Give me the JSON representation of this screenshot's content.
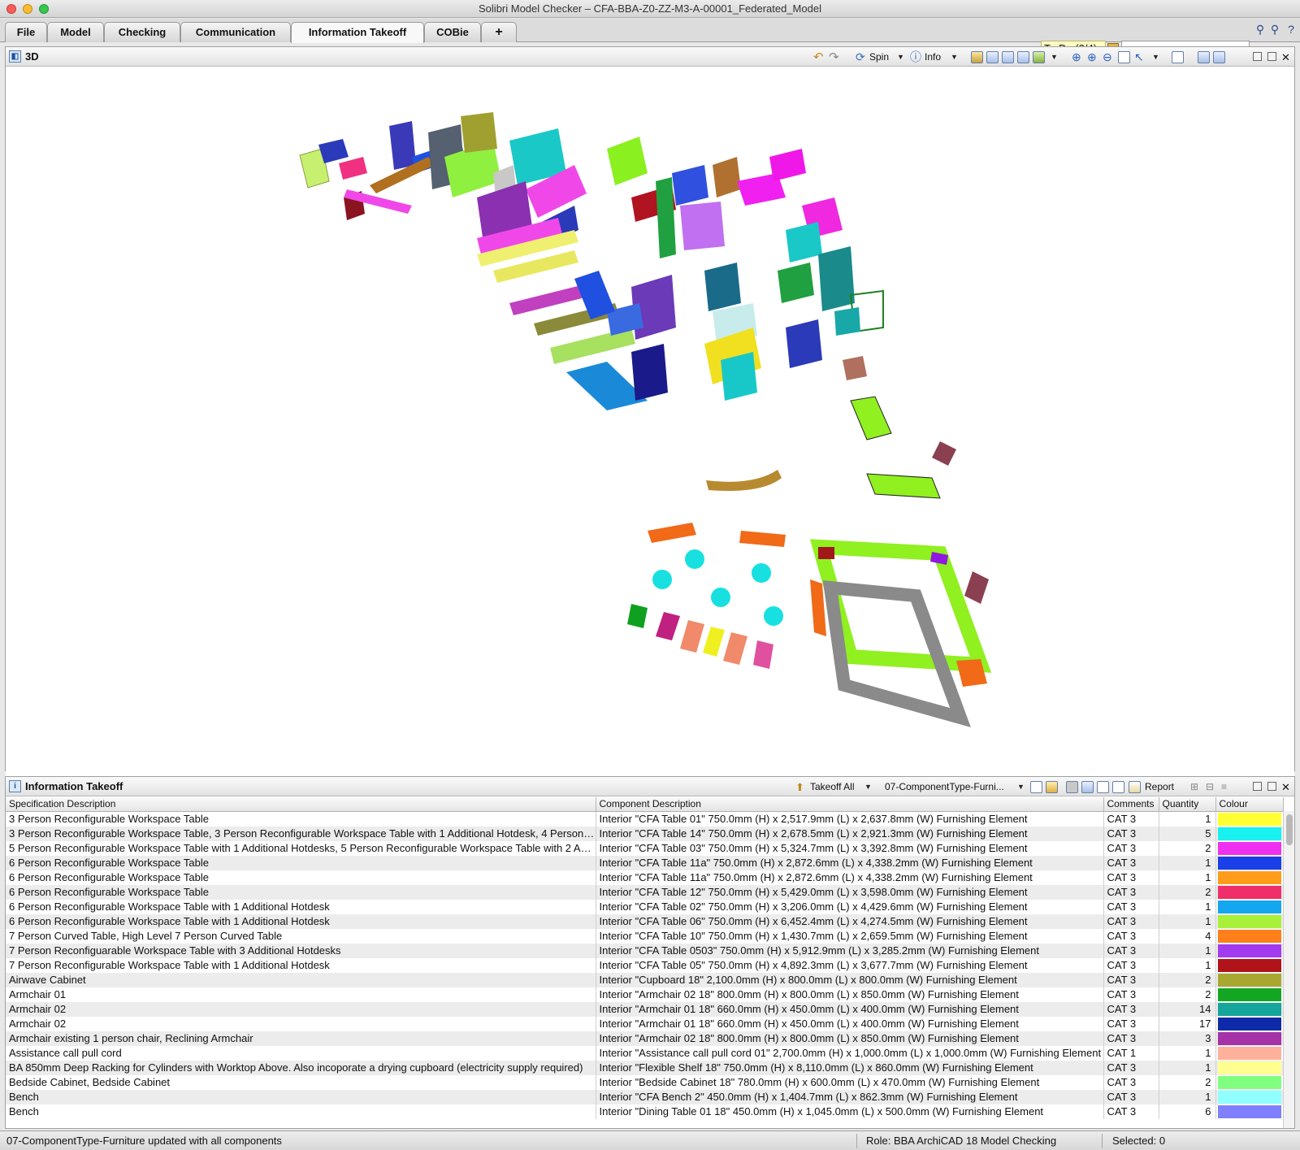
{
  "window": {
    "title": "Solibri Model Checker – CFA-BBA-Z0-ZZ-M3-A-00001_Federated_Model"
  },
  "tabs": [
    "File",
    "Model",
    "Checking",
    "Communication",
    "Information Takeoff",
    "COBie",
    "+"
  ],
  "todo": {
    "label": "To-Do (2/4)"
  },
  "search": {
    "value": ""
  },
  "view3d": {
    "title": "3D",
    "spin_label": "Spin",
    "info_label": "Info"
  },
  "takeoff": {
    "title": "Information Takeoff",
    "takeoff_all_label": "Takeoff All",
    "definition_label": "07-ComponentType-Furni...",
    "report_label": "Report",
    "columns": [
      "Specification Description",
      "Component Description",
      "Comments",
      "Quantity",
      "Colour"
    ],
    "rows": [
      {
        "spec": "3 Person Reconfigurable Workspace Table",
        "comp": "Interior \"CFA Table 01\" 750.0mm (H) x 2,517.9mm (L) x 2,637.8mm (W) Furnishing Element",
        "comments": "CAT 3",
        "qty": "1",
        "colour": "#ffff33"
      },
      {
        "spec": "3 Person Reconfigurable Workspace Table, 3 Person Reconfigurable Workspace Table with 1 Additional Hotdesk, 4 Person…",
        "comp": "Interior \"CFA Table 14\" 750.0mm (H) x 2,678.5mm (L) x 2,921.3mm (W) Furnishing Element",
        "comments": "CAT 3",
        "qty": "5",
        "colour": "#19f0f0"
      },
      {
        "spec": "5 Person Reconfigurable Workspace Table with 1 Additional Hotdesks, 5 Person Reconfigurable Workspace Table with 2 A…",
        "comp": "Interior \"CFA Table 03\" 750.0mm (H) x 5,324.7mm (L) x 3,392.8mm (W) Furnishing Element",
        "comments": "CAT 3",
        "qty": "2",
        "colour": "#f030f0"
      },
      {
        "spec": "6 Person Reconfigurable Workspace Table",
        "comp": "Interior \"CFA Table 11a\" 750.0mm (H) x 2,872.6mm (L) x 4,338.2mm (W) Furnishing Element",
        "comments": "CAT 3",
        "qty": "1",
        "colour": "#1a3fe8"
      },
      {
        "spec": "6 Person Reconfigurable Workspace Table",
        "comp": "Interior \"CFA Table 11a\" 750.0mm (H) x 2,872.6mm (L) x 4,338.2mm (W) Furnishing Element",
        "comments": "CAT 3",
        "qty": "1",
        "colour": "#ff9d1a"
      },
      {
        "spec": "6 Person Reconfigurable Workspace Table",
        "comp": "Interior \"CFA Table 12\" 750.0mm (H) x 5,429.0mm (L) x 3,598.0mm (W) Furnishing Element",
        "comments": "CAT 3",
        "qty": "2",
        "colour": "#f02e6a"
      },
      {
        "spec": "6 Person Reconfigurable Workspace Table with 1 Additional Hotdesk",
        "comp": "Interior \"CFA Table 02\" 750.0mm (H) x 3,206.0mm (L) x 4,429.6mm (W) Furnishing Element",
        "comments": "CAT 3",
        "qty": "1",
        "colour": "#14a6ef"
      },
      {
        "spec": "6 Person Reconfigurable Workspace Table with 1 Additional Hotdesk",
        "comp": "Interior \"CFA Table 06\" 750.0mm (H) x 6,452.4mm (L) x 4,274.5mm (W) Furnishing Element",
        "comments": "CAT 3",
        "qty": "1",
        "colour": "#a8f03a"
      },
      {
        "spec": "7 Person Curved Table, High Level 7 Person Curved Table",
        "comp": "Interior \"CFA Table 10\" 750.0mm (H) x 1,430.7mm (L) x 2,659.5mm (W) Furnishing Element",
        "comments": "CAT 3",
        "qty": "4",
        "colour": "#ff7f1a"
      },
      {
        "spec": "7 Person Reconfiguarable Workspace Table with 3 Additional Hotdesks",
        "comp": "Interior \"CFA Table 0503\" 750.0mm (H) x 5,912.9mm (L) x 3,285.2mm (W) Furnishing Element",
        "comments": "CAT 3",
        "qty": "1",
        "colour": "#a23af0"
      },
      {
        "spec": "7 Person Reconfigurable Workspace Table with 1 Additional Hotdesk",
        "comp": "Interior \"CFA Table 05\" 750.0mm (H) x 4,892.3mm (L) x 3,677.7mm (W) Furnishing Element",
        "comments": "CAT 3",
        "qty": "1",
        "colour": "#b0141a"
      },
      {
        "spec": "Airwave Cabinet",
        "comp": "Interior \"Cupboard 18\" 2,100.0mm (H) x 800.0mm (L) x 800.0mm (W) Furnishing Element",
        "comments": "CAT 3",
        "qty": "2",
        "colour": "#a8a830"
      },
      {
        "spec": "Armchair 01",
        "comp": "Interior \"Armchair 02 18\" 800.0mm (H) x 800.0mm (L) x 850.0mm (W) Furnishing Element",
        "comments": "CAT 3",
        "qty": "2",
        "colour": "#13a623"
      },
      {
        "spec": "Armchair 02",
        "comp": "Interior \"Armchair 01 18\" 660.0mm (H) x 450.0mm (L) x 400.0mm (W) Furnishing Element",
        "comments": "CAT 3",
        "qty": "14",
        "colour": "#15a59b"
      },
      {
        "spec": "Armchair 02",
        "comp": "Interior \"Armchair 01 18\" 660.0mm (H) x 450.0mm (L) x 400.0mm (W) Furnishing Element",
        "comments": "CAT 3",
        "qty": "17",
        "colour": "#0f2aa8"
      },
      {
        "spec": "Armchair existing 1 person chair, Reclining Armchair",
        "comp": "Interior \"Armchair 02 18\" 800.0mm (H) x 800.0mm (L) x 850.0mm (W) Furnishing Element",
        "comments": "CAT 3",
        "qty": "3",
        "colour": "#a632a8"
      },
      {
        "spec": "Assistance call pull cord",
        "comp": "Interior \"Assistance call pull cord 01\" 2,700.0mm (H) x 1,000.0mm (L) x 1,000.0mm (W) Furnishing Element",
        "comments": "CAT 1",
        "qty": "1",
        "colour": "#ffb09a"
      },
      {
        "spec": "BA 850mm Deep Racking for Cylinders with Worktop Above. Also incoporate a drying cupboard (electricity supply required)",
        "comp": "Interior \"Flexible Shelf 18\" 750.0mm (H) x 8,110.0mm (L) x 860.0mm (W) Furnishing Element",
        "comments": "CAT 3",
        "qty": "1",
        "colour": "#ffff90"
      },
      {
        "spec": "Bedside Cabinet, Bedside Cabinet",
        "comp": "Interior \"Bedside Cabinet 18\" 780.0mm (H) x 600.0mm (L) x 470.0mm (W) Furnishing Element",
        "comments": "CAT 3",
        "qty": "2",
        "colour": "#80ff80"
      },
      {
        "spec": "Bench",
        "comp": "Interior \"CFA Bench 2\" 450.0mm (H) x 1,404.7mm (L) x 862.3mm (W) Furnishing Element",
        "comments": "CAT 3",
        "qty": "1",
        "colour": "#90ffff"
      },
      {
        "spec": "Bench",
        "comp": "Interior \"Dining Table 01 18\" 450.0mm (H) x 1,045.0mm (L) x 500.0mm (W) Furnishing Element",
        "comments": "CAT 3",
        "qty": "6",
        "colour": "#8080ff"
      }
    ]
  },
  "status": {
    "message": "07-ComponentType-Furniture updated with all components",
    "role": "Role: BBA ArchiCAD 18 Model Checking",
    "selected": "Selected: 0"
  }
}
